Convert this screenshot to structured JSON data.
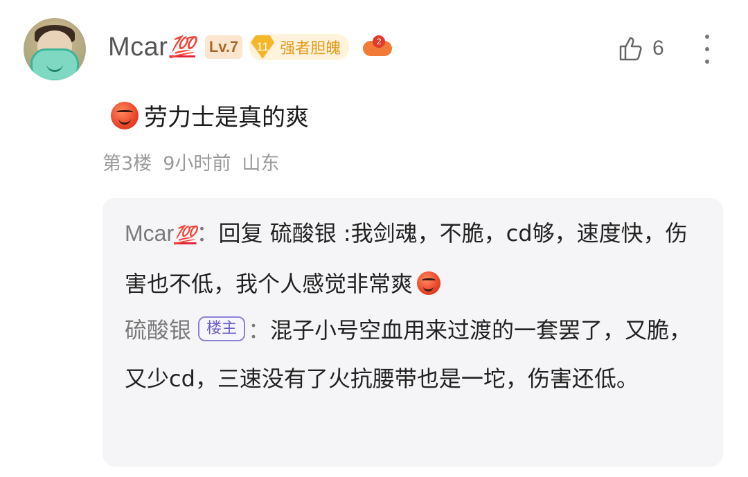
{
  "comment": {
    "user": {
      "name": "Mcar",
      "badge_100": "💯",
      "level": "Lv.7",
      "title_level": "11",
      "title": "强者胆魄",
      "game_badge_count": "2"
    },
    "likes": "6",
    "text": "劳力士是真的爽",
    "floor": "第3楼",
    "time": "9小时前",
    "location": "山东"
  },
  "replies": [
    {
      "author": "Mcar",
      "badge_100": "💯",
      "separator": "：",
      "reply_to_prefix": "回复 ",
      "reply_to": "硫酸银",
      "text": " :我剑魂，不脆，cd够，速度快，伤害也不低，我个人感觉非常爽"
    },
    {
      "author": "硫酸银",
      "owner_tag": "楼主",
      "separator": "：",
      "text": "混子小号空血用来过渡的一套罢了，又脆，又少cd，三速没有了火抗腰带也是一坨，伤害还低。"
    }
  ],
  "colors": {
    "accent_red": "#e0243a",
    "owner_tag": "#6b62c9",
    "meta": "#9a9a9a"
  }
}
